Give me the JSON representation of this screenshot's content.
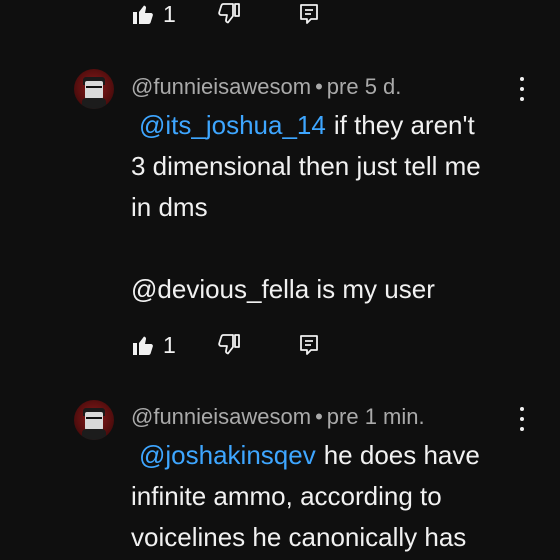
{
  "colors": {
    "background": "#0f0f0f",
    "text": "#f1f1f1",
    "meta": "#aaaaaa",
    "mention": "#3ea6ff"
  },
  "top_actions": {
    "like_count": "1",
    "like_icon": "thumbs-up-icon",
    "dislike_icon": "thumbs-down-icon",
    "reply_icon": "reply-icon"
  },
  "comments": [
    {
      "author": "@funnieisawesom",
      "separator": "•",
      "time": "pre 5 d.",
      "mention": "@its_joshua_14",
      "line1_rest": "if they aren't",
      "line2": "3 dimensional then just tell me",
      "line3": "in dms",
      "line5": "@devious_fella is my user",
      "like_count": "1",
      "menu_icon": "more-vert-icon"
    },
    {
      "author": "@funnieisawesom",
      "separator": "•",
      "time": "pre 1 min.",
      "mention": "@joshakinsqev",
      "line1_rest": "he does have",
      "line2": "infinite ammo, according to",
      "line3": "voicelines he canonically has",
      "menu_icon": "more-vert-icon"
    }
  ]
}
